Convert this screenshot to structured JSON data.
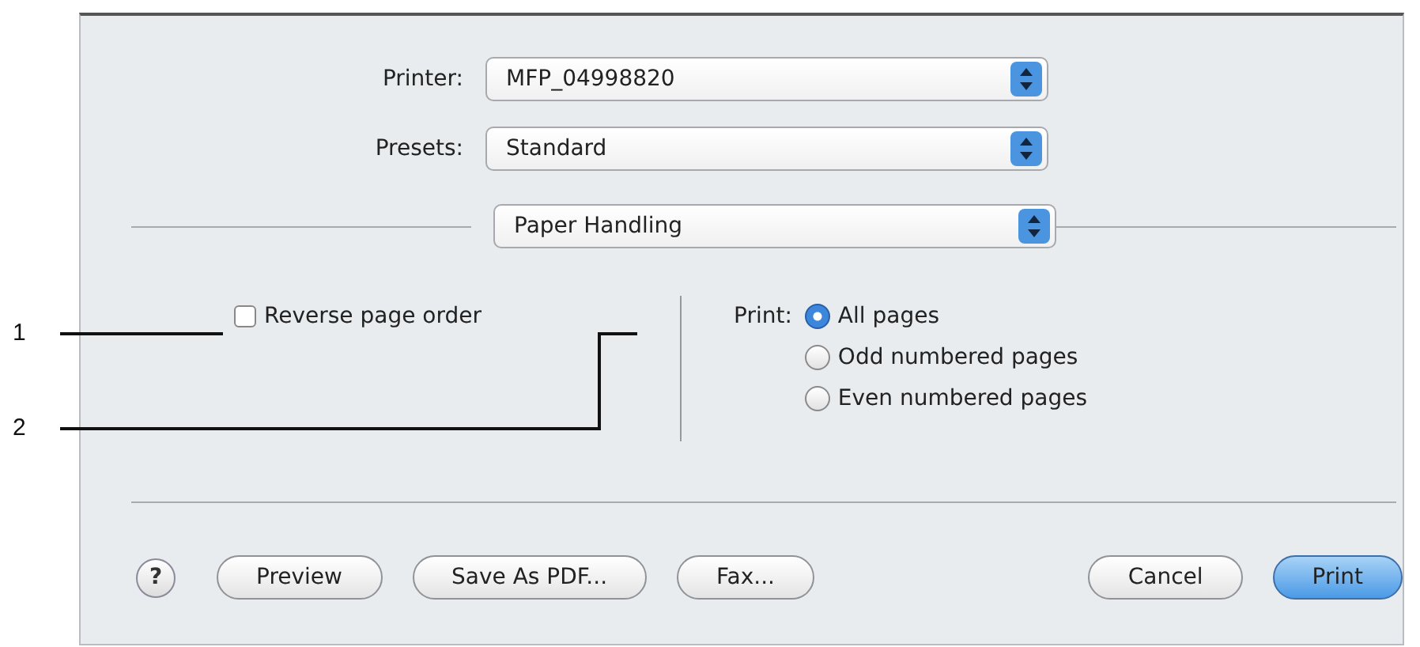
{
  "callouts": [
    {
      "label": "1"
    },
    {
      "label": "2"
    }
  ],
  "printer": {
    "label": "Printer:",
    "value": "MFP_04998820"
  },
  "presets": {
    "label": "Presets:",
    "value": "Standard"
  },
  "panel_popup": {
    "value": "Paper Handling"
  },
  "reverse_page_order": {
    "label": "Reverse page order",
    "checked": false
  },
  "print_range": {
    "label": "Print:",
    "options": [
      {
        "label": "All pages",
        "selected": true
      },
      {
        "label": "Odd numbered pages",
        "selected": false
      },
      {
        "label": "Even numbered pages",
        "selected": false
      }
    ]
  },
  "buttons": [
    {
      "kind": "help",
      "label": "?"
    },
    {
      "kind": "normal",
      "label": "Preview"
    },
    {
      "kind": "normal",
      "label": "Save As PDF..."
    },
    {
      "kind": "normal",
      "label": "Fax..."
    },
    {
      "kind": "spacer"
    },
    {
      "kind": "normal",
      "label": "Cancel"
    },
    {
      "kind": "default",
      "label": "Print"
    }
  ]
}
